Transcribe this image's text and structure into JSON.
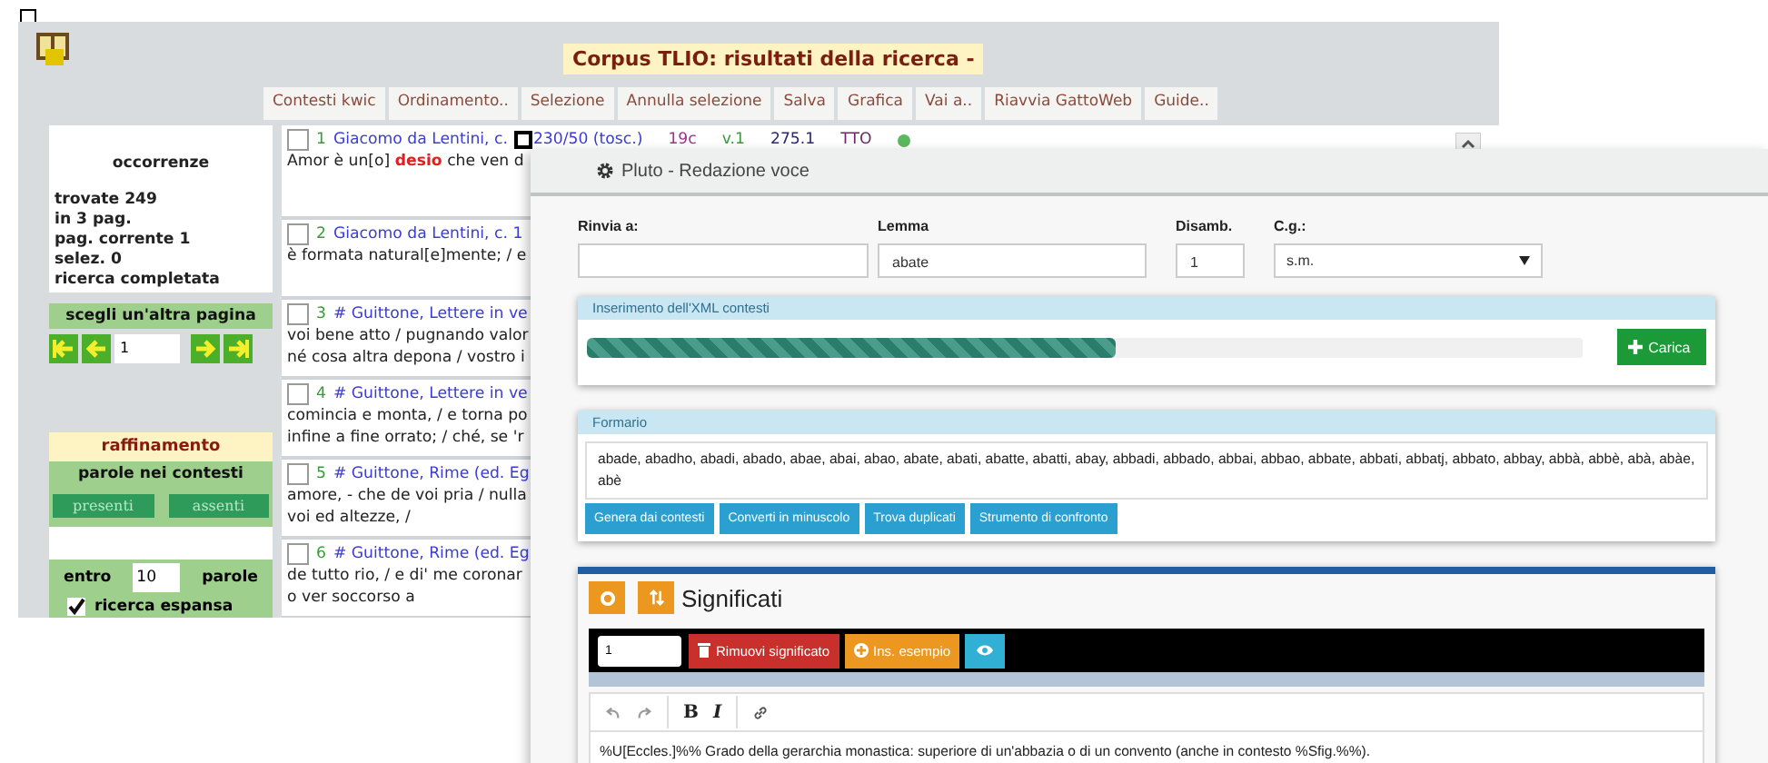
{
  "corpus_window": {
    "title": "Corpus TLIO: risultati della ricerca -",
    "menu": [
      "Contesti kwic",
      "Ordinamento..",
      "Selezione",
      "Annulla selezione",
      "Salva",
      "Grafica",
      "Vai a..",
      "Riavvia GattoWeb",
      "Guide.."
    ],
    "summary": {
      "heading": "occorrenze",
      "lines": [
        "trovate 249",
        "in 3 pag.",
        "pag. corrente 1",
        "selez. 0",
        "ricerca completata"
      ]
    },
    "page_nav": {
      "label": "scegli un'altra pagina",
      "page": "1"
    },
    "refine": {
      "title": "raffinamento",
      "words_label": "parole nei contesti",
      "buttons": [
        "presenti",
        "assenti"
      ],
      "within_label": "entro",
      "within_value": "10",
      "words_unit": "parole",
      "expanded": {
        "label": "ricerca espansa",
        "checked": true
      }
    },
    "results": [
      {
        "number": "1",
        "checked": false,
        "ref": "Giacomo da Lentini, c.",
        "ref_tail": "230/50 (tosc.)",
        "meta": [
          {
            "text": "19c",
            "color": "#a0308c"
          },
          {
            "text": "v.1",
            "color": "#3a9a3a"
          },
          {
            "text": "275.1",
            "color": "#2a2a6a"
          },
          {
            "text": "TTO",
            "color": "#6a2a6a"
          }
        ],
        "color": "#5cb85c",
        "lines": [
          "Amor è un[o] **desio** che ven d"
        ]
      },
      {
        "number": "2",
        "checked": false,
        "ref": "Giacomo da Lentini, c. 1",
        "lines": [
          "è formata natural[e]mente; / e"
        ]
      },
      {
        "number": "3",
        "checked": false,
        "ref": "# Guittone, Lettere in ve",
        "lines": [
          "voi bene atto / pugnando valor",
          "né cosa altra depona / vostro i"
        ]
      },
      {
        "number": "4",
        "checked": false,
        "ref": "# Guittone, Lettere in ve",
        "lines": [
          "comincia e monta, / e torna po",
          "infine a fine orrato; / ché, se 'r"
        ]
      },
      {
        "number": "5",
        "checked": false,
        "ref": "# Guittone, Rime (ed. Eg",
        "lines": [
          "amore, - che de voi pria / nulla",
          "voi ed altezze, /"
        ]
      },
      {
        "number": "6",
        "checked": false,
        "ref": "# Guittone, Rime (ed. Eg",
        "lines": [
          "de tutto rio, / e di' me coronar",
          "o ver soccorso a"
        ]
      }
    ]
  },
  "editor": {
    "title": "Pluto - Redazione voce",
    "fields": [
      {
        "label": "Rinvia a:",
        "kind": "text"
      },
      {
        "label": "Lemma",
        "value": "abate",
        "kind": "text"
      },
      {
        "label": "Disamb.",
        "value": "1",
        "kind": "text"
      },
      {
        "label": "C.g.:",
        "value": "s.m.",
        "kind": "select"
      }
    ],
    "xml_panel": {
      "title": "Inserimento dell'XML contesti",
      "level": 0.53,
      "button": "Carica"
    },
    "formario": {
      "title": "Formario",
      "text": "abade, abadho, abadi, abado, abae, abai, abao, abate, abati, abatte, abatti, abay, abbadi, abbado, abbai, abbao, abbate, abbati, abbatj, abbato, abbay, abbà, abbè, abà, abàe, abè",
      "buttons": [
        "Genera dai contesti",
        "Converti in minuscolo",
        "Trova duplicati",
        "Strumento di confronto"
      ]
    },
    "significati": {
      "title": "Significati",
      "number": "1",
      "buttons": [
        {
          "label": "Rimuovi significato",
          "kind": "danger"
        },
        {
          "label": "Ins. esempio",
          "kind": "warning"
        }
      ],
      "format_buttons": [
        "B",
        "I"
      ],
      "text": "%U[Eccles.]%% Grado della gerarchia monastica: superiore di un'abbazia o di un convento (anche in contesto %Sfig.%%)."
    }
  }
}
